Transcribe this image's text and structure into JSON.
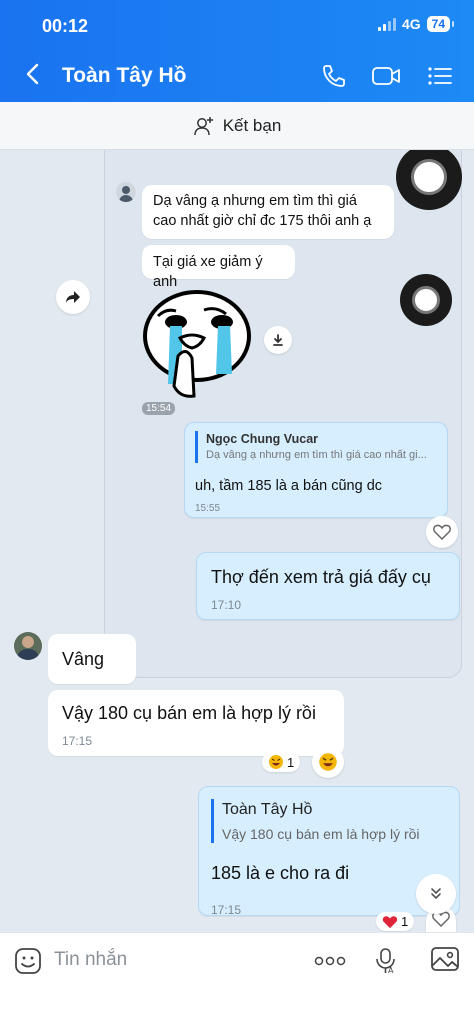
{
  "status": {
    "time": "00:12",
    "network": "4G",
    "battery": "74"
  },
  "header": {
    "title": "Toàn Tây Hồ",
    "back_icon": "chevron-left-icon",
    "call_icon": "phone-icon",
    "video_icon": "video-camera-icon",
    "menu_icon": "list-menu-icon"
  },
  "friend_bar": {
    "label": "Kết bạn",
    "icon": "add-user-icon"
  },
  "quoted_block": {
    "messages": [
      {
        "text": "Dạ vâng ạ nhưng em tìm thì giá cao nhất giờ chỉ đc 175 thôi anh ạ"
      },
      {
        "text": "Tại giá xe giảm ý anh"
      }
    ],
    "sticker_time": "15:54",
    "reply": {
      "quoted_name": "Ngọc Chung Vucar",
      "quoted_text": "Dạ vâng ạ nhưng em tìm thì giá cao nhất gi...",
      "text": "uh, tầm 185 là a bán cũng dc",
      "time": "15:55"
    }
  },
  "messages": [
    {
      "text": "Thợ đến xem trả giá đấy cụ",
      "time": "17:10"
    },
    {
      "text": "Vâng"
    },
    {
      "text": "Vậy 180 cụ bán em là hợp lý rồi",
      "time": "17:15",
      "reaction_count": "1"
    },
    {
      "reply_name": "Toàn Tây Hồ",
      "reply_text": "Vậy 180 cụ bán em là hợp lý rồi",
      "text": "185 là e cho ra đi",
      "time": "17:15",
      "reaction_count": "1"
    }
  ],
  "input": {
    "placeholder": "Tin nhắn"
  },
  "colors": {
    "brand": "#1a73f0",
    "my_bubble": "#d6eefe",
    "chat_bg": "#e2e9f1",
    "heart": "#e0243a"
  }
}
